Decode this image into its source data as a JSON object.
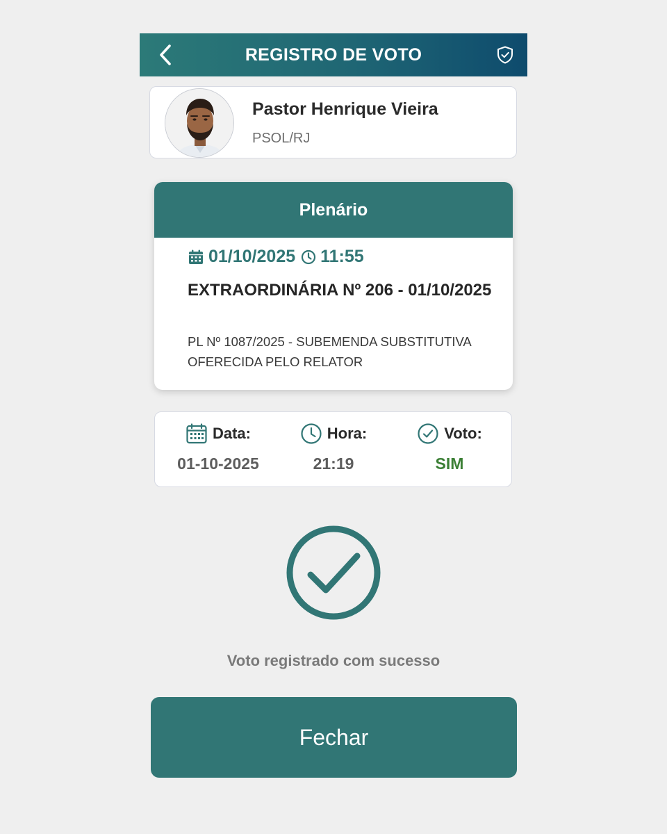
{
  "header": {
    "title": "REGISTRO DE VOTO",
    "back_icon": "chevron-left-icon",
    "shield_icon": "shield-check-icon"
  },
  "profile": {
    "name": "Pastor Henrique Vieira",
    "party": "PSOL/RJ"
  },
  "session": {
    "header": "Plenário",
    "date": "01/10/2025",
    "time": "11:55",
    "title": "EXTRAORDINÁRIA Nº 206 - 01/10/2025",
    "description": "PL Nº 1087/2025 - SUBEMENDA SUBSTITUTIVA OFERECIDA PELO RELATOR"
  },
  "vote_info": {
    "date_label": "Data:",
    "date_value": "01-10-2025",
    "time_label": "Hora:",
    "time_value": "21:19",
    "vote_label": "Voto:",
    "vote_value": "SIM"
  },
  "success": {
    "message": "Voto registrado com sucesso"
  },
  "close_button": {
    "label": "Fechar"
  },
  "colors": {
    "primary": "#317675",
    "header_gradient_end": "#0e4b6d",
    "vote_yes": "#3b7f35",
    "background": "#efefef"
  }
}
